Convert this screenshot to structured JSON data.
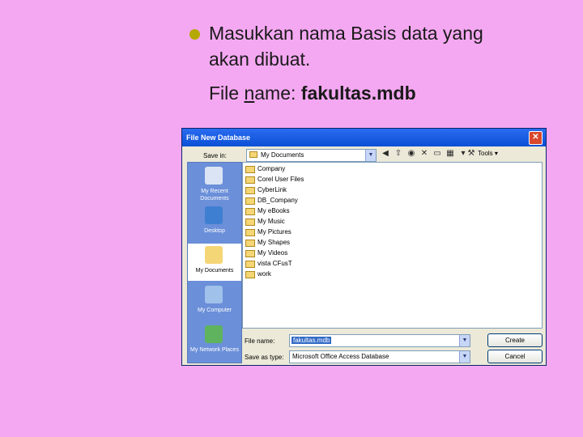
{
  "slide": {
    "bullet_line1": "Masukkan nama Basis data yang",
    "bullet_line2": "akan dibuat.",
    "filename_prefix_f": "File ",
    "filename_prefix_n": "n",
    "filename_prefix_rest": "ame: ",
    "filename_value": "fakultas.mdb",
    "bullet_color": "#b5a800",
    "background": "#f5a8f2"
  },
  "dialog": {
    "title": "File New Database",
    "close_glyph": "✕",
    "save_in_label": "Save in:",
    "save_in_value": "My Documents",
    "tools_label": "Tools ▾",
    "places": [
      {
        "label": "My Recent Documents",
        "icon": "recent-documents-icon"
      },
      {
        "label": "Desktop",
        "icon": "desktop-icon"
      },
      {
        "label": "My Documents",
        "icon": "my-documents-icon"
      },
      {
        "label": "My Computer",
        "icon": "my-computer-icon"
      },
      {
        "label": "My Network Places",
        "icon": "network-places-icon"
      }
    ],
    "files": [
      "Company",
      "Corel User Files",
      "CyberLink",
      "DB_Company",
      "My eBooks",
      "My Music",
      "My Pictures",
      "My Shapes",
      "My Videos",
      "vista CFusT",
      "work"
    ],
    "file_name_label": "File name:",
    "file_name_value": "fakultas.mdb",
    "save_as_type_label": "Save as type:",
    "save_as_type_value": "Microsoft Office Access Database",
    "create_label": "Create",
    "cancel_label": "Cancel"
  }
}
